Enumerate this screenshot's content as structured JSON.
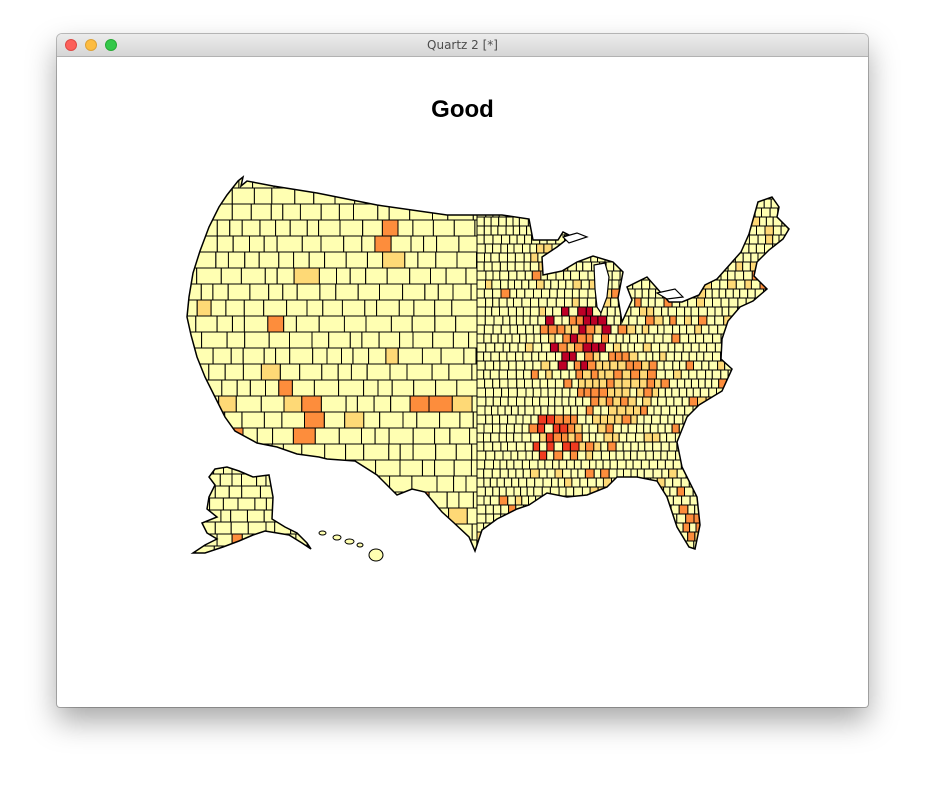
{
  "window": {
    "title": "Quartz 2 [*]"
  },
  "plot": {
    "title": "Good"
  },
  "palette": {
    "low": "#ffffb2",
    "mid_low": "#fed976",
    "mid": "#fd8d3c",
    "high": "#f03b20",
    "very_high": "#bd0026"
  }
}
